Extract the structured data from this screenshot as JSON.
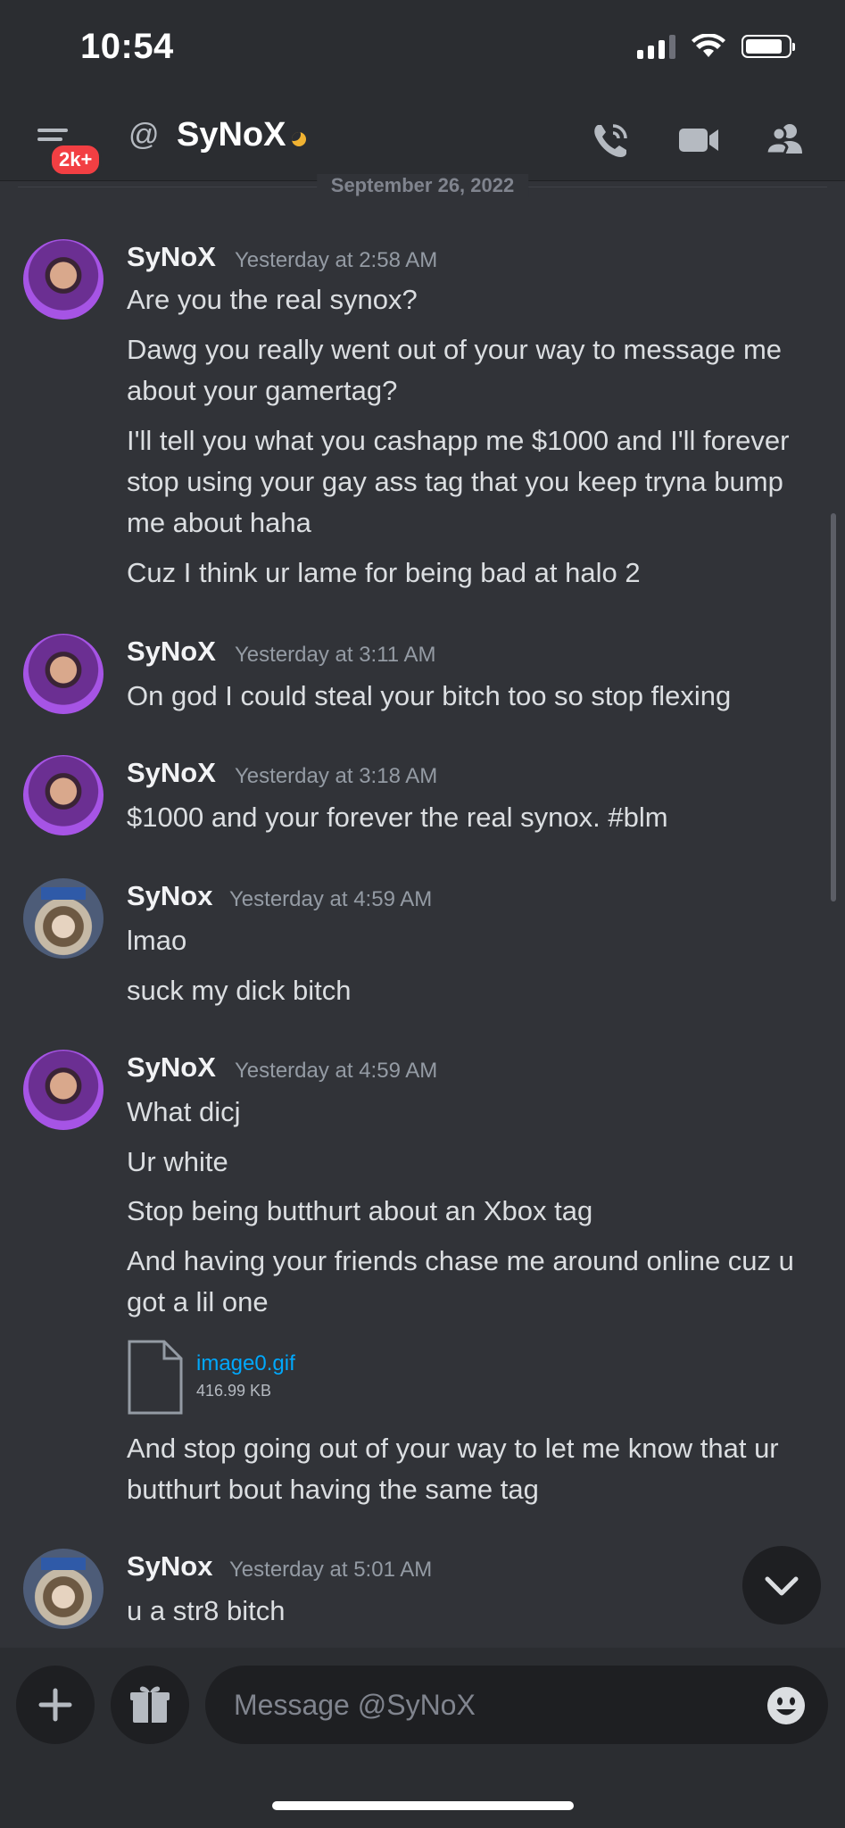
{
  "status_bar": {
    "time": "10:54"
  },
  "header": {
    "badge": "2k+",
    "at_symbol": "@",
    "title": "SyNoX",
    "status_color": "#f0b232",
    "icons": [
      "call-icon",
      "video-call-icon",
      "members-icon"
    ]
  },
  "date_separator": "September 26, 2022",
  "messages": [
    {
      "author": "SyNoX",
      "timestamp": "Yesterday at 2:58 AM",
      "lines": [
        "Are you the real synox?",
        "Dawg you really went out of your way to message me about your gamertag?",
        "I'll tell you what you cashapp me $1000 and I'll forever stop using your gay ass tag that you keep tryna bump me about haha",
        "Cuz I think ur lame for being bad at halo 2"
      ]
    },
    {
      "author": "SyNoX",
      "timestamp": "Yesterday at 3:11 AM",
      "lines": [
        "On god I could steal your bitch too so stop flexing"
      ]
    },
    {
      "author": "SyNoX",
      "timestamp": "Yesterday at 3:18 AM",
      "lines": [
        "$1000 and your forever the real synox. #blm"
      ]
    },
    {
      "author": "SyNox",
      "timestamp": "Yesterday at 4:59 AM",
      "lines": [
        "lmao",
        "suck my dick bitch"
      ]
    },
    {
      "author": "SyNoX",
      "timestamp": "Yesterday at 4:59 AM",
      "lines": [
        "What dicj",
        "Ur white",
        "Stop being butthurt about an Xbox tag",
        "And having your friends chase me around online cuz u got a lil one"
      ],
      "attachment": {
        "name": "image0.gif",
        "size": "416.99 KB"
      },
      "after_attachment": "And stop going out of your way to let me know that ur butthurt bout having the same tag"
    },
    {
      "author": "SyNox",
      "timestamp": "Yesterday at 5:01 AM",
      "lines": [
        "u a str8 bitch"
      ]
    }
  ],
  "composer": {
    "placeholder": "Message @SyNoX"
  },
  "colors": {
    "background": "#313338",
    "header": "#2b2d31",
    "link": "#00a8fc",
    "badge": "#f23f43"
  }
}
